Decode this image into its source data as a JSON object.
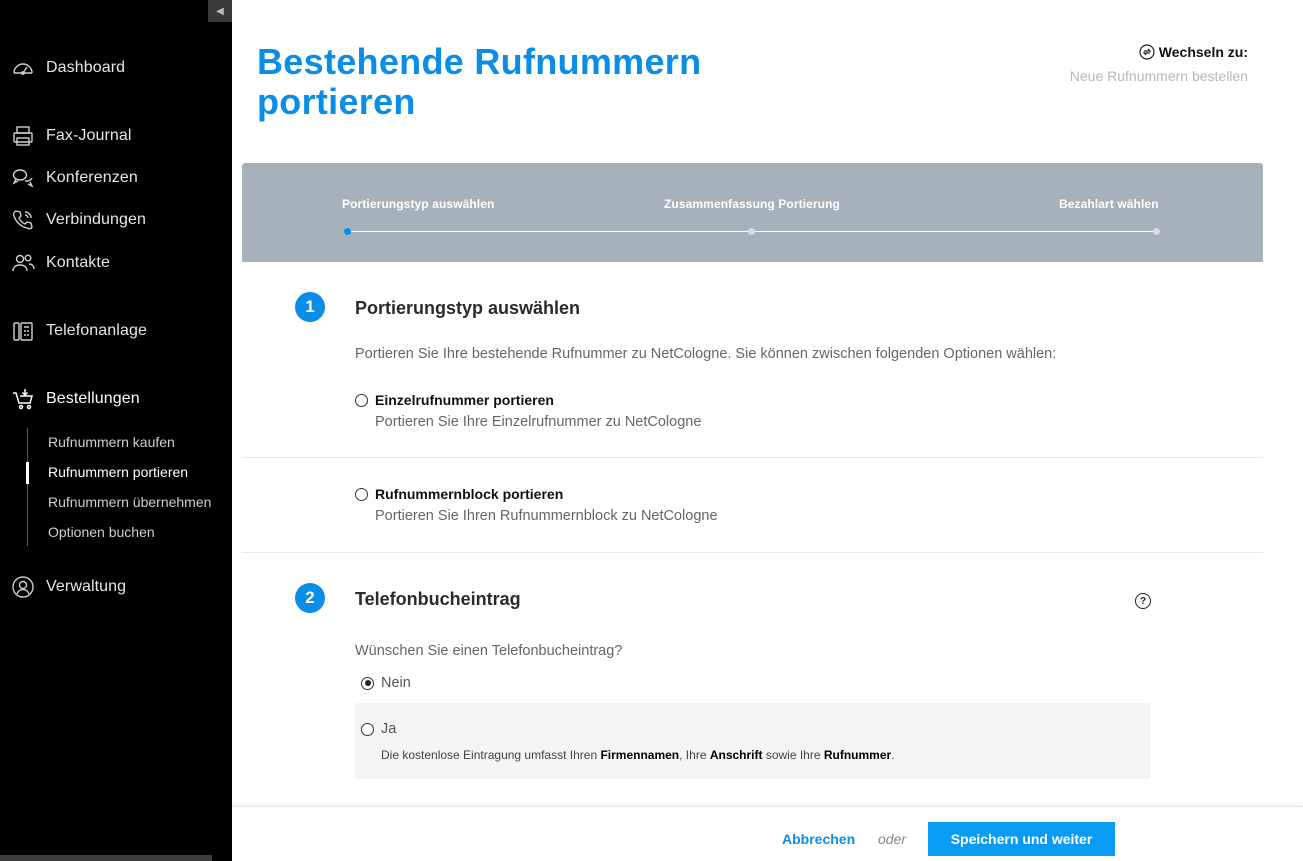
{
  "sidebar": {
    "collapse_icon": "triangle-left-icon",
    "items": [
      {
        "key": "dashboard",
        "label": "Dashboard",
        "icon": "speedometer-icon"
      },
      {
        "key": "fax",
        "label": "Fax-Journal",
        "icon": "printer-icon"
      },
      {
        "key": "konf",
        "label": "Konferenzen",
        "icon": "chat-bubbles-icon"
      },
      {
        "key": "verb",
        "label": "Verbindungen",
        "icon": "phone-call-icon"
      },
      {
        "key": "kontakte",
        "label": "Kontakte",
        "icon": "people-icon"
      },
      {
        "key": "anlage",
        "label": "Telefonanlage",
        "icon": "desk-phone-icon"
      },
      {
        "key": "bestellungen",
        "label": "Bestellungen",
        "icon": "shopping-cart-icon"
      },
      {
        "key": "verwaltung",
        "label": "Verwaltung",
        "icon": "user-circle-icon"
      }
    ],
    "sub_items": [
      {
        "label": "Rufnummern kaufen"
      },
      {
        "label": "Rufnummern portieren"
      },
      {
        "label": "Rufnummern übernehmen"
      },
      {
        "label": "Optionen buchen"
      }
    ]
  },
  "header": {
    "title_line1": "Bestehende Rufnummern",
    "title_line2": "portieren",
    "switch_label": "Wechseln zu:",
    "switch_link": "Neue Rufnummern bestellen"
  },
  "stepper": {
    "steps": [
      {
        "label": "Portierungstyp auswählen"
      },
      {
        "label": "Zusammenfassung Portierung"
      },
      {
        "label": "Bezahlart wählen"
      }
    ],
    "current_step": 1
  },
  "section1": {
    "number": "1",
    "title": "Portierungstyp auswählen",
    "intro": "Portieren Sie Ihre bestehende Rufnummer zu NetCologne. Sie können zwischen folgenden Optionen wählen:",
    "options": [
      {
        "label": "Einzelrufnummer portieren",
        "desc": "Portieren Sie Ihre Einzelrufnummer zu NetCologne",
        "checked": false
      },
      {
        "label": "Rufnummernblock portieren",
        "desc": "Portieren Sie Ihren Rufnummernblock zu NetCologne",
        "checked": false
      }
    ]
  },
  "section2": {
    "number": "2",
    "title": "Telefonbucheintrag",
    "help": "?",
    "question": "Wünschen Sie einen Telefonbucheintrag?",
    "opt_nein": "Nein",
    "opt_ja": "Ja",
    "note_prefix": "Die kostenlose Eintragung umfasst Ihren ",
    "note_b1": "Firmennamen",
    "note_mid1": ", Ihre ",
    "note_b2": "Anschrift",
    "note_mid2": " sowie Ihre ",
    "note_b3": "Rufnummer",
    "note_end": "."
  },
  "footer": {
    "cancel": "Abbrechen",
    "or": "oder",
    "save": "Speichern und weiter"
  },
  "colors": {
    "accent": "#0a8de6",
    "button": "#0a9cf5",
    "stepper_bg": "#a7b1bb",
    "sidebar_bg": "#000000"
  }
}
